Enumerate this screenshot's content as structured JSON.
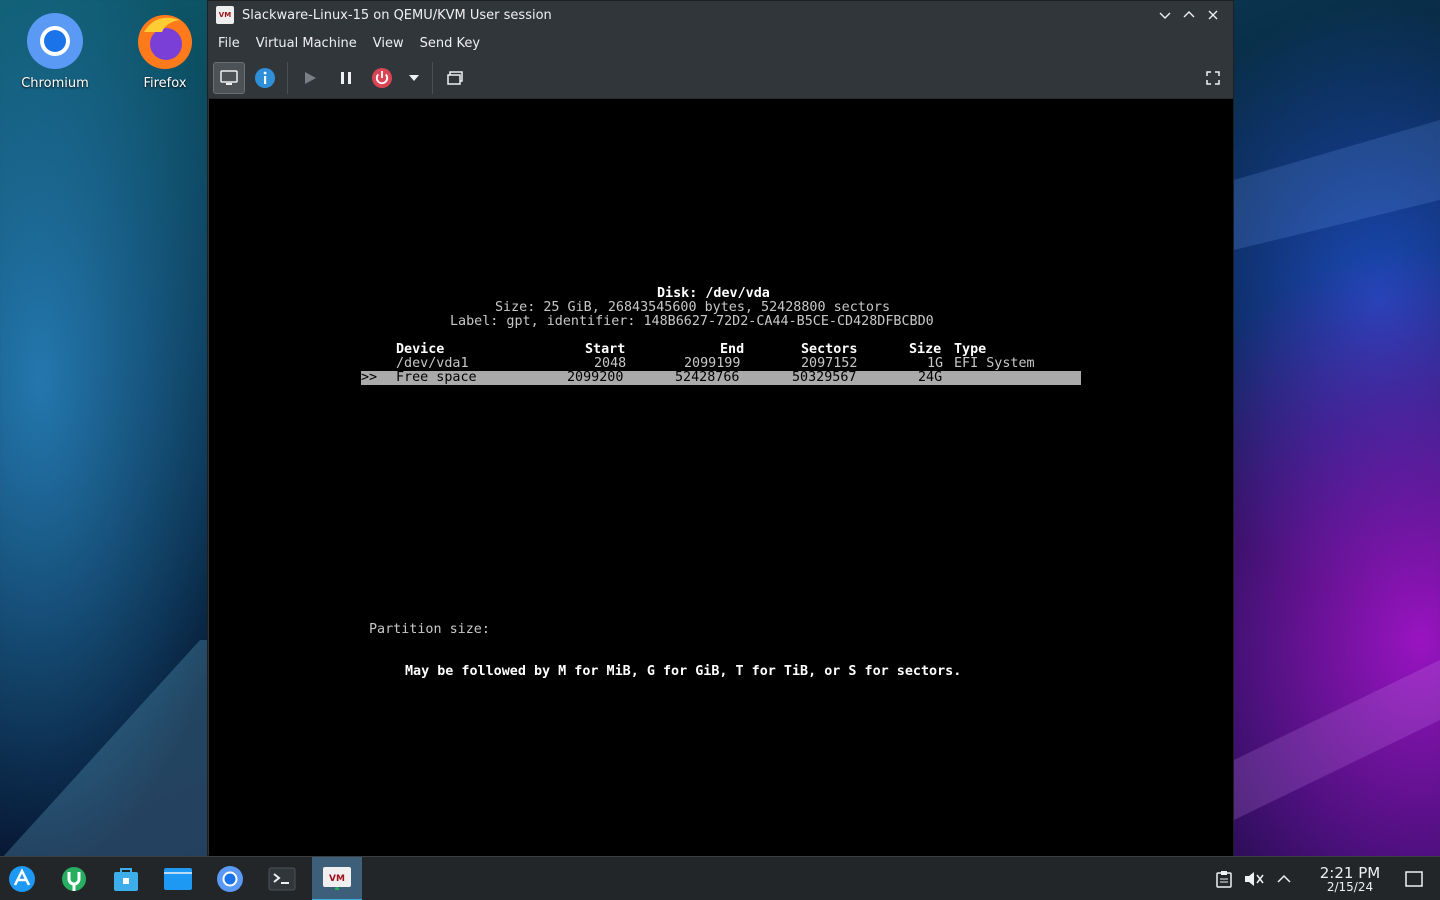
{
  "desktop": {
    "icons": [
      {
        "label": "Chromium",
        "icon": "chromium-icon"
      },
      {
        "label": "Firefox",
        "icon": "firefox-icon"
      }
    ]
  },
  "window": {
    "title": "Slackware-Linux-15 on QEMU/KVM User session",
    "app_icon_text": "VM",
    "menu": [
      "File",
      "Virtual Machine",
      "View",
      "Send Key"
    ],
    "toolbar": [
      "console-view",
      "details-info",
      "run",
      "pause",
      "shutdown",
      "shutdown-menu",
      "snapshots",
      "fullscreen"
    ]
  },
  "console": {
    "disk_title": "Disk: /dev/vda",
    "size_line": "Size: 25 GiB, 26843545600 bytes, 52428800 sectors",
    "label_line": "Label: gpt, identifier: 148B6627-72D2-CA44-B5CE-CD428DFBCBD0",
    "columns": {
      "device": "Device",
      "start": "Start",
      "end": "End",
      "sectors": "Sectors",
      "size": "Size",
      "type": "Type"
    },
    "rows": [
      {
        "marker": "",
        "device": "/dev/vda1",
        "start": "2048",
        "end": "2099199",
        "sectors": "2097152",
        "size": "1G",
        "type": "EFI System",
        "selected": false
      },
      {
        "marker": ">>",
        "device": "Free space",
        "start": "2099200",
        "end": "52428766",
        "sectors": "50329567",
        "size": "24G",
        "type": "",
        "selected": true
      }
    ],
    "prompt": "Partition size:",
    "hint": "May be followed by M for MiB, G for GiB, T for TiB, or S for sectors."
  },
  "taskbar": {
    "apps": [
      "app-launcher-icon",
      "discover-icon",
      "store-icon",
      "file-manager-icon",
      "chromium-icon",
      "terminal-icon",
      "virt-manager-icon"
    ],
    "active_app": "virt-manager-icon",
    "clock_time": "2:21 PM",
    "clock_date": "2/15/24"
  },
  "colors": {
    "window_bg": "#31363b",
    "taskbar_bg": "#232629",
    "accent": "#3daee9",
    "console_bg": "#000000",
    "highlight_row": "#aaaaaa"
  }
}
